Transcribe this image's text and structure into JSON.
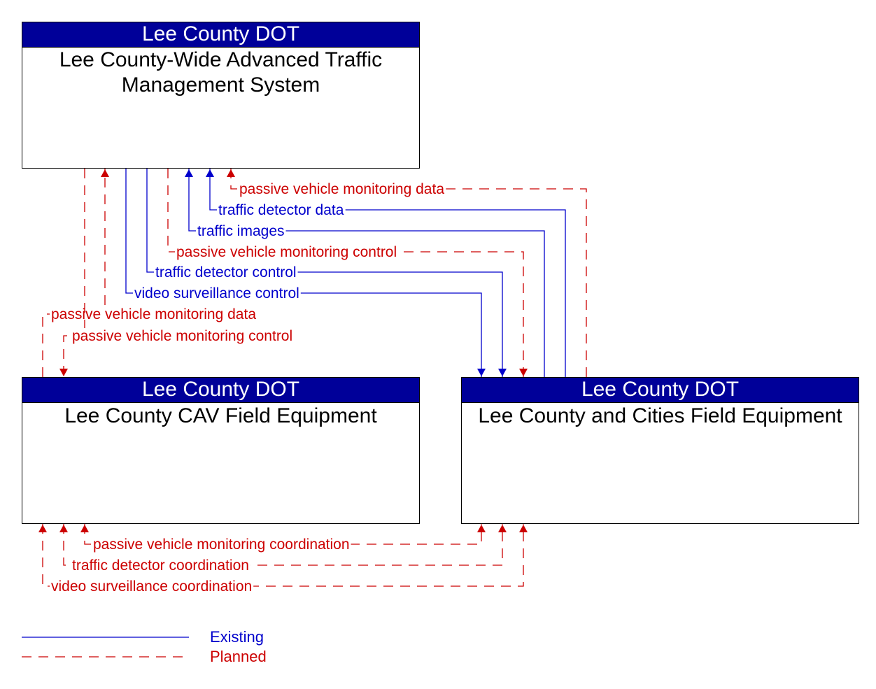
{
  "colors": {
    "existing": "#0000CC",
    "planned": "#CC0000",
    "header_bg": "#000099"
  },
  "boxes": {
    "atms": {
      "owner": "Lee County DOT",
      "name": "Lee County-Wide Advanced Traffic Management System"
    },
    "cav": {
      "owner": "Lee County DOT",
      "name": "Lee County CAV Field Equipment"
    },
    "field": {
      "owner": "Lee County DOT",
      "name": "Lee County and Cities Field Equipment"
    }
  },
  "flows": [
    {
      "label": "passive vehicle monitoring data",
      "from": "field",
      "to": "atms",
      "status": "planned"
    },
    {
      "label": "traffic detector data",
      "from": "field",
      "to": "atms",
      "status": "existing"
    },
    {
      "label": "traffic images",
      "from": "field",
      "to": "atms",
      "status": "existing"
    },
    {
      "label": "passive vehicle monitoring control",
      "from": "atms",
      "to": "field",
      "status": "planned"
    },
    {
      "label": "traffic detector control",
      "from": "atms",
      "to": "field",
      "status": "existing"
    },
    {
      "label": "video surveillance control",
      "from": "atms",
      "to": "field",
      "status": "existing"
    },
    {
      "label": "passive vehicle monitoring data",
      "from": "cav",
      "to": "atms",
      "status": "planned"
    },
    {
      "label": "passive vehicle monitoring control",
      "from": "atms",
      "to": "cav",
      "status": "planned"
    },
    {
      "label": "passive vehicle monitoring coordination",
      "from": "cav",
      "to": "field",
      "status": "planned",
      "bidirectional": true
    },
    {
      "label": "traffic detector coordination",
      "from": "cav",
      "to": "field",
      "status": "planned",
      "bidirectional": true
    },
    {
      "label": "video surveillance coordination",
      "from": "cav",
      "to": "field",
      "status": "planned",
      "bidirectional": true
    }
  ],
  "legend": {
    "existing": "Existing",
    "planned": "Planned"
  }
}
